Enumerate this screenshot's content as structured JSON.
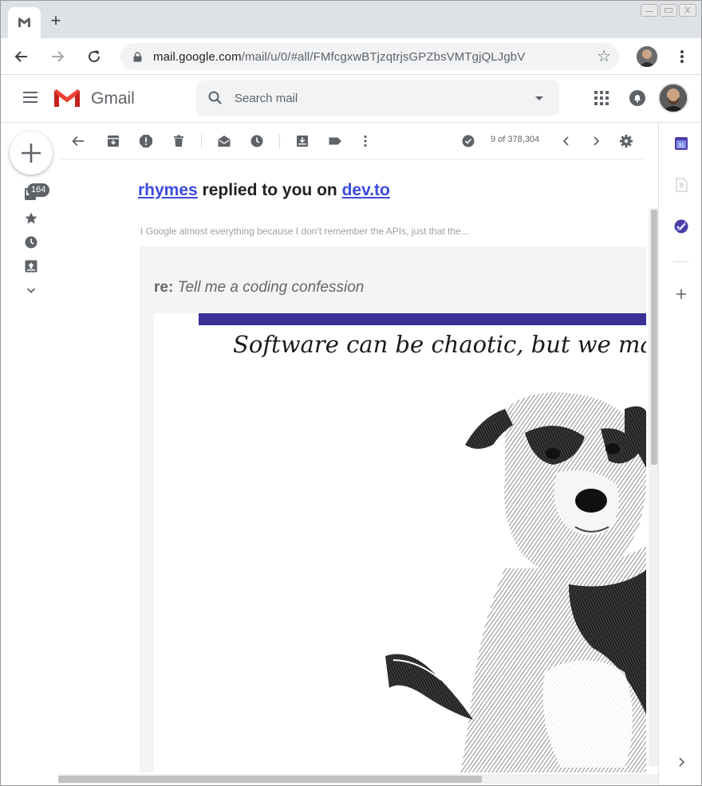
{
  "browser": {
    "tab_title": "",
    "url_host": "mail.google.com",
    "url_path": "/mail/u/0/#all/FMfcgxwBTjzqtrjsGPZbsVMTgjQLJgbV",
    "new_tab_label": "+"
  },
  "gmail": {
    "app_name": "Gmail",
    "search_placeholder": "Search mail"
  },
  "rail": {
    "inbox_badge": "164"
  },
  "toolbar": {
    "message_count": "9 of 378,304"
  },
  "message": {
    "sender": "rhymes",
    "subject_middle": " replied to you on ",
    "site": "dev.to",
    "snippet": "I Google almost everything because I don't remember the APIs, just that the...",
    "re_prefix": "re:",
    "re_title": "Tell me a coding confession",
    "cover_title": "Software can be chaotic, but we make"
  },
  "colors": {
    "link": "#3b49df",
    "cover_bar": "#3a3096",
    "gmail_red": "#ea4335",
    "icon_gray": "#5f6368"
  },
  "icons": {
    "browser": [
      "gmail-favicon",
      "back-arrow-icon",
      "forward-arrow-icon",
      "reload-icon",
      "lock-icon",
      "bookmark-star-icon",
      "chrome-menu-icon"
    ],
    "gmail_header": [
      "hamburger-menu-icon",
      "search-icon",
      "apps-grid-icon",
      "notifications-icon"
    ],
    "rail": [
      "compose-plus-icon",
      "inbox-icon",
      "starred-icon",
      "snoozed-icon",
      "important-icon",
      "more-chevron-icon"
    ],
    "actions": [
      "back-to-list-icon",
      "archive-icon",
      "report-spam-icon",
      "delete-icon",
      "mark-unread-icon",
      "snooze-icon",
      "move-to-icon",
      "label-icon",
      "more-actions-icon",
      "split-pane-icon",
      "prev-icon",
      "next-icon",
      "settings-icon"
    ],
    "side_panel": [
      "calendar-icon",
      "keep-icon",
      "tasks-icon",
      "add-addon-icon",
      "expand-panel-icon"
    ]
  }
}
